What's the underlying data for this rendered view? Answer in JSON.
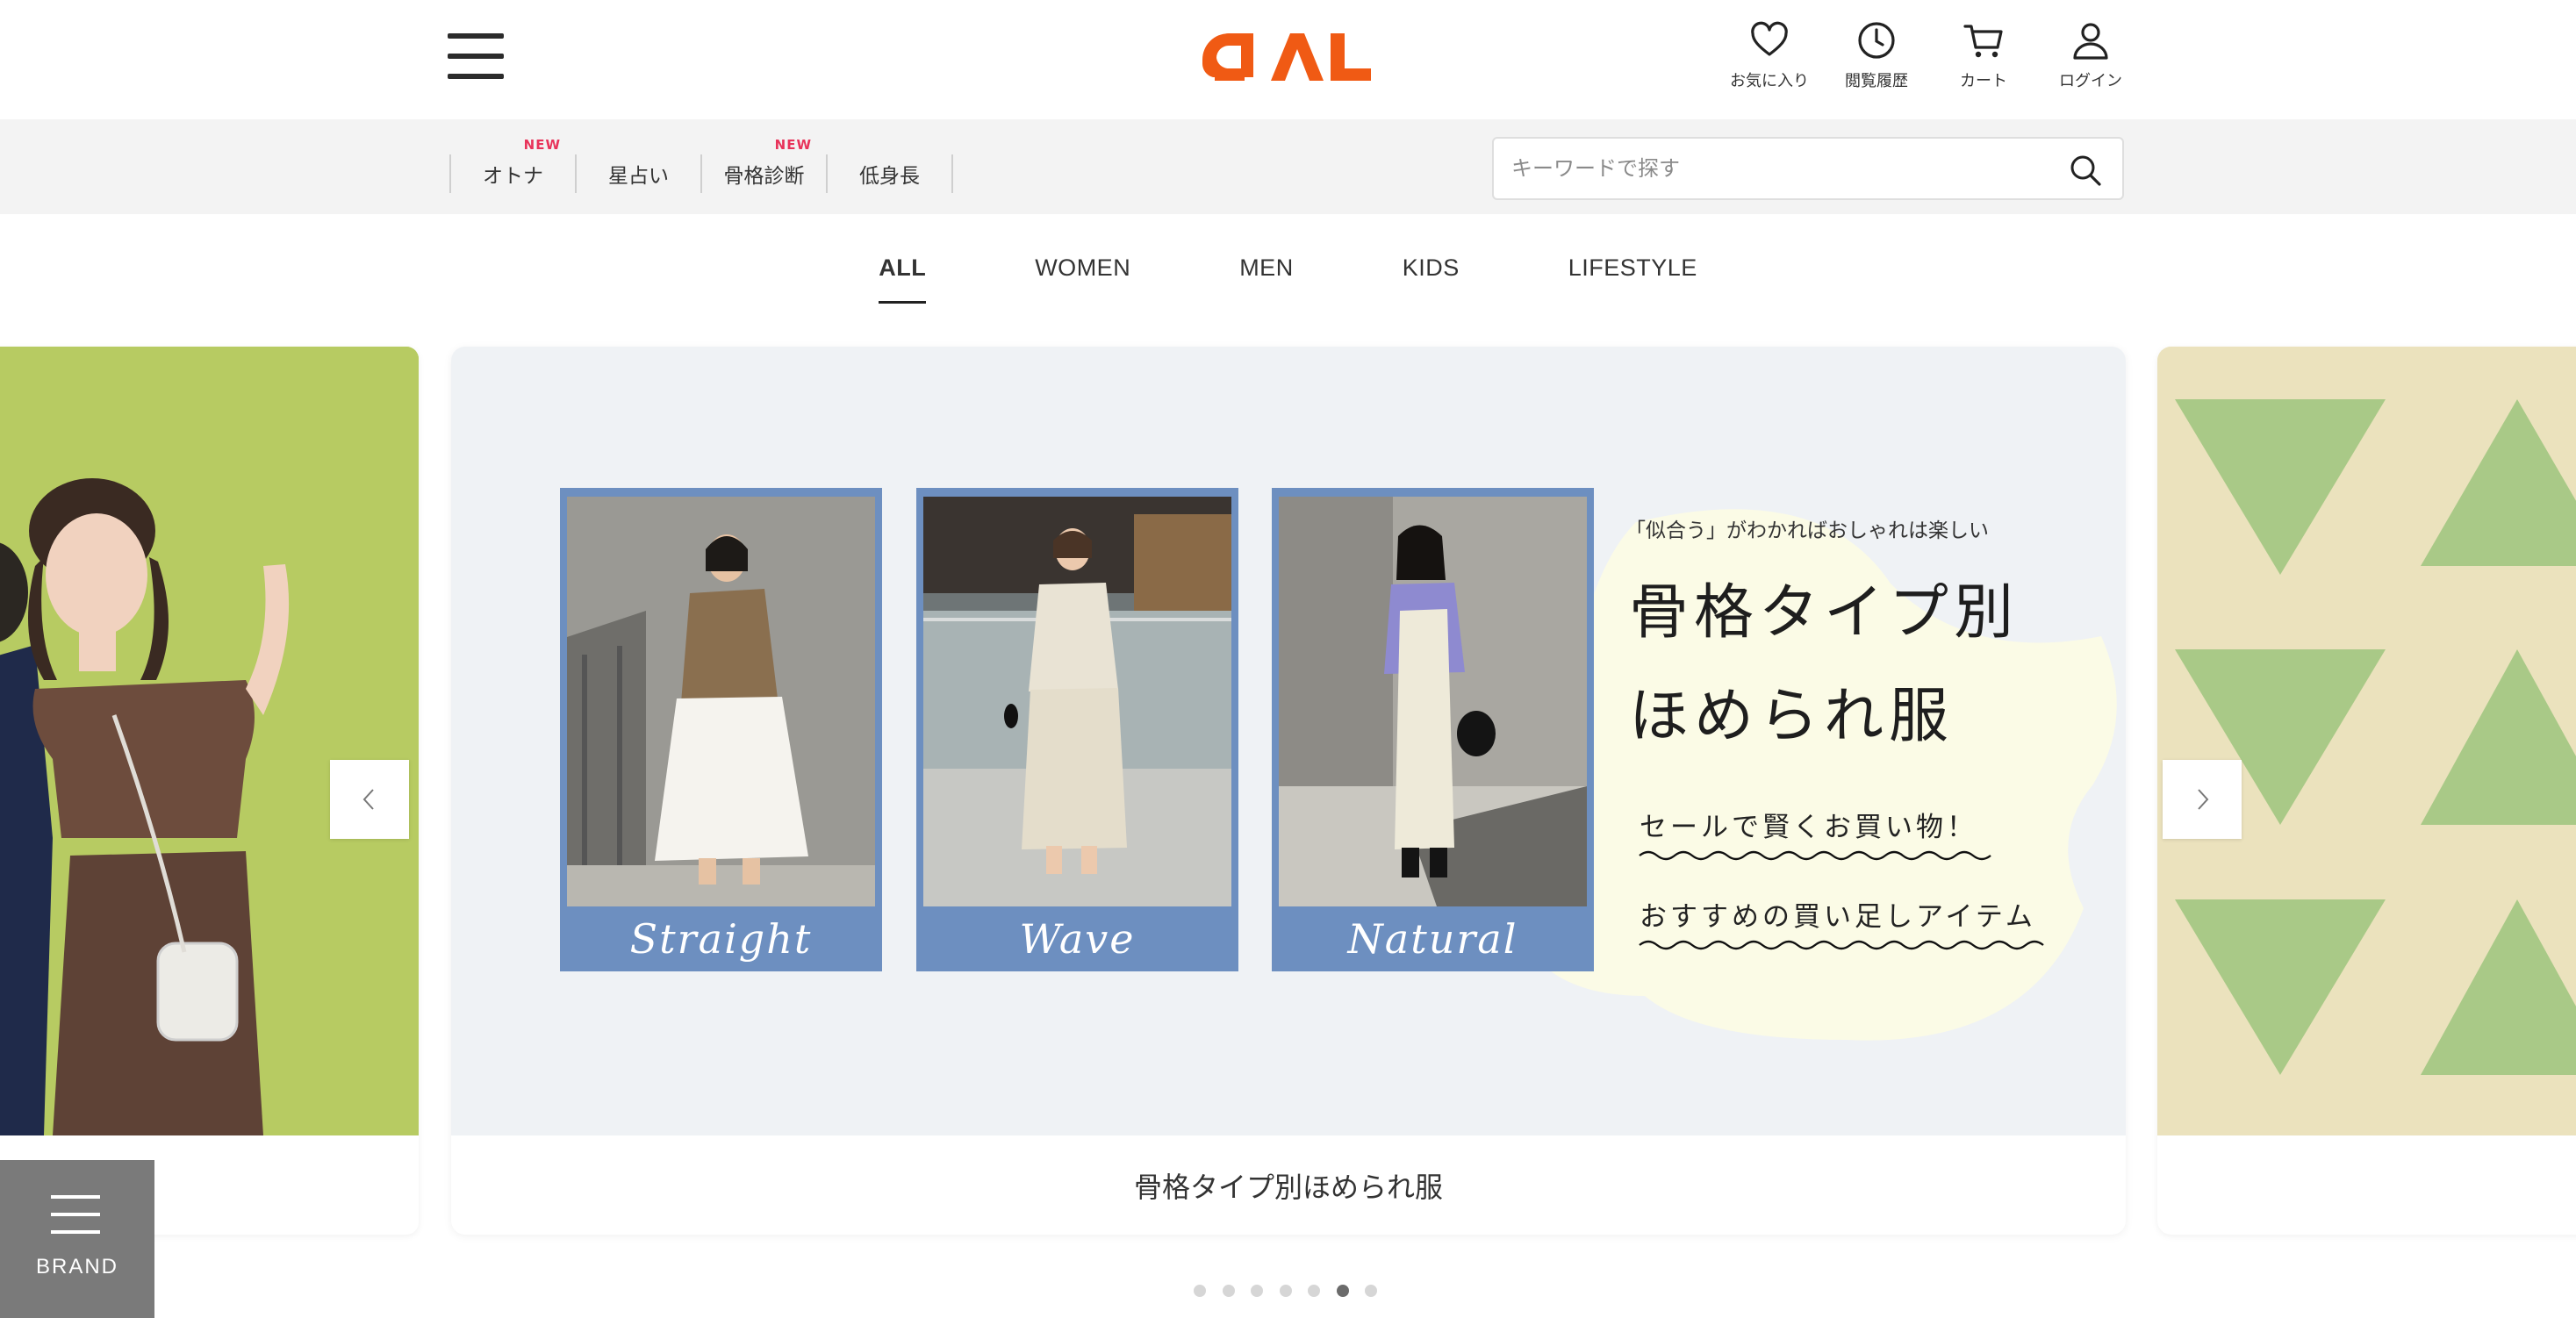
{
  "header": {
    "menu_icon": "hamburger-menu-icon",
    "logo_text": "PAL",
    "brand_color": "#f05a14",
    "icons": [
      {
        "name": "heart-icon",
        "label": "お気に入り"
      },
      {
        "name": "clock-icon",
        "label": "閲覧履歴"
      },
      {
        "name": "cart-icon",
        "label": "カート"
      },
      {
        "name": "user-icon",
        "label": "ログイン"
      }
    ]
  },
  "subnav": {
    "items": [
      {
        "label": "オトナ",
        "badge": "NEW"
      },
      {
        "label": "星占い",
        "badge": ""
      },
      {
        "label": "骨格診断",
        "badge": "NEW"
      },
      {
        "label": "低身長",
        "badge": ""
      }
    ],
    "badge_color": "#e8335a",
    "search": {
      "placeholder": "キーワードで探す",
      "value": "",
      "icon": "search-icon"
    }
  },
  "category_tabs": [
    {
      "label": "ALL",
      "active": true
    },
    {
      "label": "WOMEN",
      "active": false
    },
    {
      "label": "MEN",
      "active": false
    },
    {
      "label": "KIDS",
      "active": false
    },
    {
      "label": "LIFESTYLE",
      "active": false
    }
  ],
  "carousel": {
    "main": {
      "photos": [
        {
          "label": "Straight"
        },
        {
          "label": "Wave"
        },
        {
          "label": "Natural"
        }
      ],
      "subtitle": "「似合う」がわかればおしゃれは楽しい",
      "title_line1": "骨格タイプ別",
      "title_line2": "ほめられ服",
      "link1": "セールで賢くお買い物！",
      "link2": "おすすめの買い足しアイテム",
      "caption": "骨格タイプ別ほめられ服"
    },
    "prev_icon": "chevron-left-icon",
    "next_icon": "chevron-right-icon",
    "dots_total": 7,
    "dots_active_index": 5
  },
  "brand_button": {
    "label": "BRAND",
    "icon": "menu-lines-icon"
  }
}
